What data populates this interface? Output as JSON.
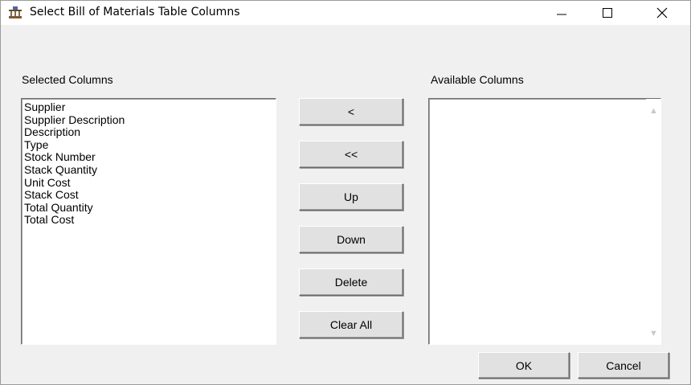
{
  "window": {
    "title": "Select Bill of Materials Table Columns",
    "icon": "bill-of-materials-app-icon",
    "controls": {
      "minimize": "—",
      "maximize": "☐",
      "close": "✕"
    }
  },
  "selected_columns": {
    "label": "Selected Columns",
    "items": [
      "Supplier",
      "Supplier Description",
      "Description",
      "Type",
      "Stock Number",
      "Stack Quantity",
      "Unit Cost",
      "Stack Cost",
      "Total Quantity",
      "Total Cost"
    ]
  },
  "available_columns": {
    "label": "Available Columns",
    "items": []
  },
  "buttons": {
    "add": "<",
    "add_all": "<<",
    "up": "Up",
    "down": "Down",
    "delete": "Delete",
    "clear_all": "Clear All",
    "ok": "OK",
    "cancel": "Cancel"
  }
}
